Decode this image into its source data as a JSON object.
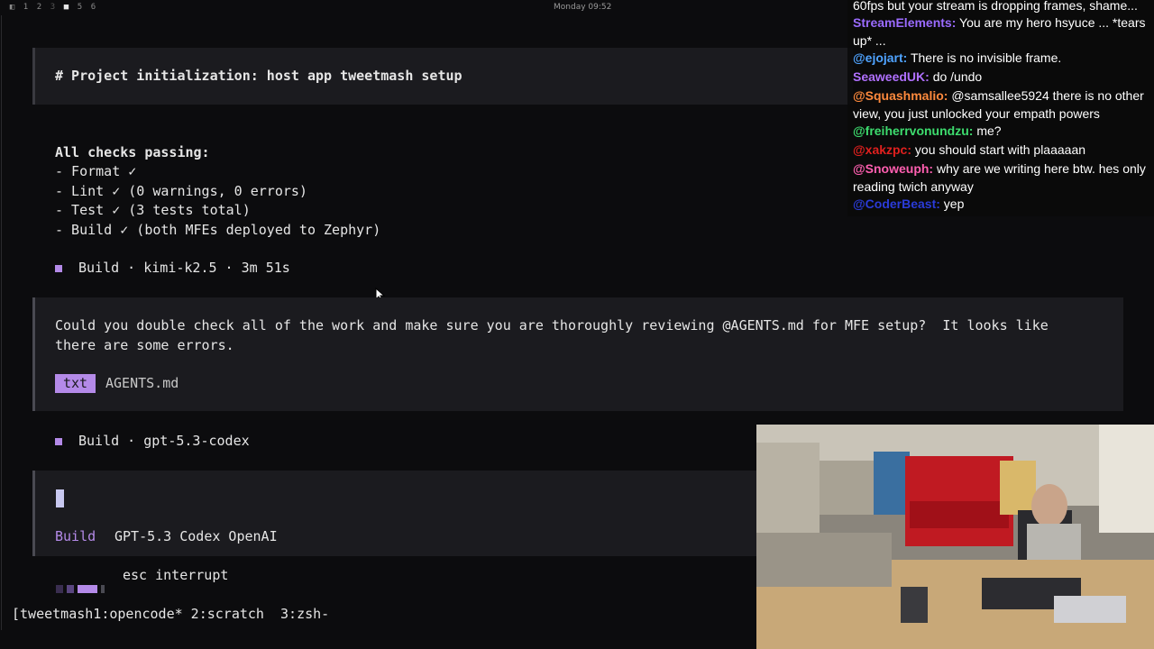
{
  "topbar": {
    "workspaces": [
      "1",
      "2",
      "3",
      "5",
      "6"
    ],
    "clock": "Monday 09:52"
  },
  "session": {
    "heading": "# Project initialization: host app tweetmash setup",
    "checks_title": "All checks passing:",
    "checks": [
      "- Format ✓",
      "- Lint ✓ (0 warnings, 0 errors)",
      "- Test ✓ (3 tests total)",
      "- Build ✓ (both MFEs deployed to Zephyr)"
    ],
    "build_line_1": "Build · kimi-k2.5 · 3m 51s",
    "prompt_line_1": "Could you double check all of the work and make sure you are thoroughly reviewing @AGENTS.md for MFE setup?  It looks like",
    "prompt_line_2": "there are some errors.",
    "attachment_badge": "txt",
    "attachment_name": "AGENTS.md",
    "build_line_2": "Build · gpt-5.3-codex",
    "mode_label": "Build",
    "model_label": "GPT-5.3 Codex OpenAI",
    "interrupt_hint": "esc interrupt"
  },
  "tmux": {
    "status": "[tweetmash1:opencode* 2:scratch  3:zsh-"
  },
  "chat": {
    "messages": [
      {
        "user": "",
        "text": "60fps but your stream is dropping frames, shame...",
        "color": "#ffffff"
      },
      {
        "user": "StreamElements:",
        "text": " You are my hero hsyuce ... *tears up* ...",
        "color": "#9b6bff"
      },
      {
        "user": "@ejojart:",
        "text": " There is no invisible frame.",
        "color": "#4fa3ff"
      },
      {
        "user": "SeaweedUK:",
        "text": " do /undo",
        "color": "#b070ff"
      },
      {
        "user": "@Squashmalio:",
        "text": " @samsallee5924 there is no other view, you just unlocked your empath powers",
        "color": "#ff8a3d"
      },
      {
        "user": "@freiherrvonundzu:",
        "text": " me?",
        "color": "#3ddc6e"
      },
      {
        "user": "@xakzpc:",
        "text": " you should start with plaaaaan",
        "color": "#e0201e"
      },
      {
        "user": "@Snoweuph:",
        "text": " why are we writing here btw. hes only reading twich anyway",
        "color": "#ff5fb0"
      },
      {
        "user": "@CoderBeast:",
        "text": " yep",
        "color": "#2a3bd8"
      }
    ]
  },
  "colors": {
    "accent": "#b48ae8",
    "block_bg": "#1b1b1f",
    "background": "#0c0c0e"
  }
}
